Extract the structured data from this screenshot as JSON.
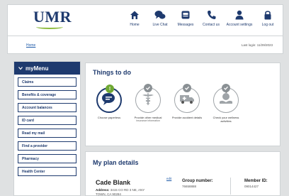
{
  "header": {
    "logo": "UMR",
    "nav": [
      {
        "label": "Home",
        "icon": "home-icon"
      },
      {
        "label": "Live Chat",
        "icon": "chat-icon"
      },
      {
        "label": "Messages",
        "icon": "messages-icon"
      },
      {
        "label": "Contact us",
        "icon": "phone-icon"
      },
      {
        "label": "Account settings",
        "icon": "user-icon"
      },
      {
        "label": "Log out",
        "icon": "lock-icon"
      }
    ]
  },
  "subbar": {
    "home_link": "Home",
    "last_login": "Last login: 11/29/2023"
  },
  "sidebar": {
    "title": "myMenu",
    "items": [
      "Claims",
      "Benefits & coverage",
      "Account balances",
      "ID card",
      "Read my mail",
      "Find a provider",
      "Pharmacy",
      "Health Center"
    ]
  },
  "todo": {
    "title": "Things to do",
    "tasks": [
      {
        "label": "Choose paperless",
        "sub": "",
        "icon": "paperless-icon",
        "badge": "!",
        "status": "active"
      },
      {
        "label": "Provide other medical",
        "sub": "insurance information",
        "icon": "caduceus-icon",
        "badge": "check",
        "status": "done"
      },
      {
        "label": "Provide accident details",
        "sub": "",
        "icon": "ambulance-icon",
        "badge": "check",
        "status": "done"
      },
      {
        "label": "Check your wellness activities",
        "sub": "",
        "icon": "wellness-icon",
        "badge": "check",
        "status": "done"
      }
    ]
  },
  "plan": {
    "title": "My plan details",
    "member_name": "Cade Blank",
    "address_label": "Address:",
    "address_line1": "3415 CO RD 3 NE, ANY",
    "address_line2": "TOWN, CA 90284",
    "edit_link": "edit",
    "group_label": "Group number:",
    "group_value": "76658888",
    "member_label": "Member ID:",
    "member_value": "09014427"
  },
  "colors": {
    "navy": "#1e3a6e",
    "green": "#6ea832",
    "gray_badge": "#8a9094",
    "background": "#dfe1e2"
  }
}
